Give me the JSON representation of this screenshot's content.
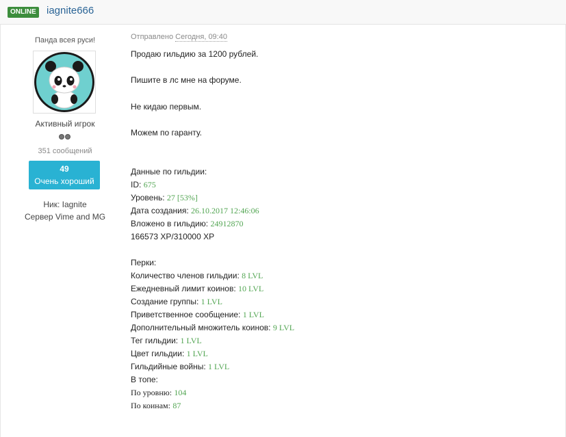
{
  "header": {
    "status_badge": "ONLINE",
    "username": "iagnite666"
  },
  "sidebar": {
    "custom_title": "Панда всея руси!",
    "avatar_icon": "panda-avatar-icon",
    "rank": "Активный игрок",
    "message_count": "351 сообщений",
    "reputation_value": "49",
    "reputation_label": "Очень хороший",
    "nick_line": "Ник: Iagnite",
    "server_line": "Сервер Vime and MG"
  },
  "post": {
    "sent_label": "Отправлено",
    "sent_date": "Сегодня, 09:40",
    "intro": [
      "Продаю гильдию за 1200 рублей.",
      "Пишите в лс мне на форуме.",
      "Не кидаю первым.",
      "Можем по гаранту."
    ],
    "guild_heading": "Данные по гильдии:",
    "guild": {
      "id_label": "ID:",
      "id_value": "675",
      "level_label": "Уровень:",
      "level_value": "27",
      "level_open": " [",
      "level_percent": "53%",
      "level_close": "]",
      "created_label": "Дата создания:",
      "created_value": "26.10.2017 12:46:06",
      "invested_label": "Вложено в гильдию:",
      "invested_value": "24912870",
      "xp_line": "166573 XP/310000 XP"
    },
    "perks_heading": "Перки:",
    "perks": [
      {
        "label": "Количество членов гильдии:",
        "value": "8 LVL"
      },
      {
        "label": "Ежедневный лимит коинов:",
        "value": "10 LVL"
      },
      {
        "label": "Создание группы:",
        "value": "1 LVL"
      },
      {
        "label": "Приветственное сообщение:",
        "value": "1 LVL"
      },
      {
        "label": "Дополнительный множитель коинов:",
        "value": "9 LVL"
      },
      {
        "label": "Тег гильдии:",
        "value": "1 LVL"
      },
      {
        "label": "Цвет гильдии:",
        "value": "1 LVL"
      },
      {
        "label": "Гильдийные войны:",
        "value": "1 LVL"
      }
    ],
    "top_heading": "В топе:",
    "top": [
      {
        "label": "По уровню:",
        "value": "104"
      },
      {
        "label": "По коинам:",
        "value": "87"
      }
    ]
  },
  "colors": {
    "online_badge": "#3c8d3c",
    "username_link": "#2a6496",
    "reputation_bg": "#29b2d3",
    "value_green": "#52a552",
    "panda_bg": "#6fd0cf"
  }
}
